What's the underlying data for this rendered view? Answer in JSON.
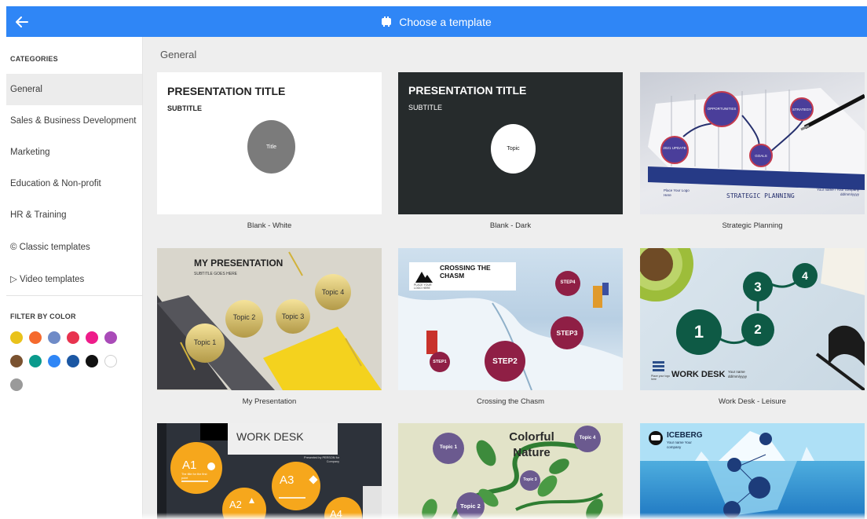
{
  "header": {
    "title": "Choose a template",
    "back_icon": "arrow-left-icon",
    "title_icon": "template-icon"
  },
  "sidebar": {
    "categories_title": "CATEGORIES",
    "categories": [
      {
        "label": "General",
        "active": true
      },
      {
        "label": "Sales & Business Development",
        "active": false
      },
      {
        "label": "Marketing",
        "active": false
      },
      {
        "label": "Education & Non-profit",
        "active": false
      },
      {
        "label": "HR & Training",
        "active": false
      },
      {
        "label": "© Classic templates",
        "active": false
      },
      {
        "label": "▷ Video templates",
        "active": false
      }
    ],
    "filter_title": "FILTER BY COLOR",
    "colors": [
      "#e9c21b",
      "#f56a2e",
      "#6f8bc7",
      "#e8334f",
      "#ee1c8a",
      "#a94bb8",
      "#7a5230",
      "#0a9a8c",
      "#2f86f6",
      "#1b57a3",
      "#111111",
      "#ffffff",
      "#9a9a9a"
    ]
  },
  "main": {
    "section_title": "General",
    "templates": [
      {
        "name": "Blank - White",
        "title": "PRESENTATION TITLE",
        "subtitle": "SUBTITLE",
        "topic": "Title"
      },
      {
        "name": "Blank - Dark",
        "title": "PRESENTATION TITLE",
        "subtitle": "SUBTITLE",
        "topic": "Topic"
      },
      {
        "name": "Strategic Planning",
        "heading": "STRATEGIC PLANNING",
        "logo": "Place Your Logo Here",
        "meta": "Your name / Your company dd/mm/yyyy",
        "bubbles": [
          "OPPORTUNITIES",
          "STRATEGY",
          "2021 UPDATE",
          "GOALS"
        ]
      },
      {
        "name": "My Presentation",
        "title": "MY PRESENTATION",
        "subtitle": "SUBTITLE GOES HERE",
        "topics": [
          "Topic 1",
          "Topic 2",
          "Topic 3",
          "Topic 4"
        ]
      },
      {
        "name": "Crossing the Chasm",
        "title": "CROSSING THE CHASM",
        "logo": "PLACE YOUR LOGO HERE",
        "steps": [
          "STEP1",
          "STEP2",
          "STEP3",
          "STEP4"
        ]
      },
      {
        "name": "Work Desk - Leisure",
        "title": "WORK DESK",
        "meta": "Your name dd/mm/yyyy",
        "logo": "Place your logo here",
        "numbers": [
          "1",
          "2",
          "3",
          "4"
        ]
      },
      {
        "name": "Work Desk",
        "title": "WORK DESK",
        "presented": "Presented by PERSON for Company",
        "items": [
          "A1",
          "A2",
          "A3",
          "A4"
        ],
        "desc": "The title for the first point"
      },
      {
        "name": "Colorful Nature",
        "title": "Colorful Nature",
        "topics": [
          "Topic 1",
          "Topic 2",
          "Topic 3",
          "Topic 4"
        ]
      },
      {
        "name": "Iceberg",
        "title": "ICEBERG",
        "meta": "Your name Your company"
      }
    ]
  }
}
